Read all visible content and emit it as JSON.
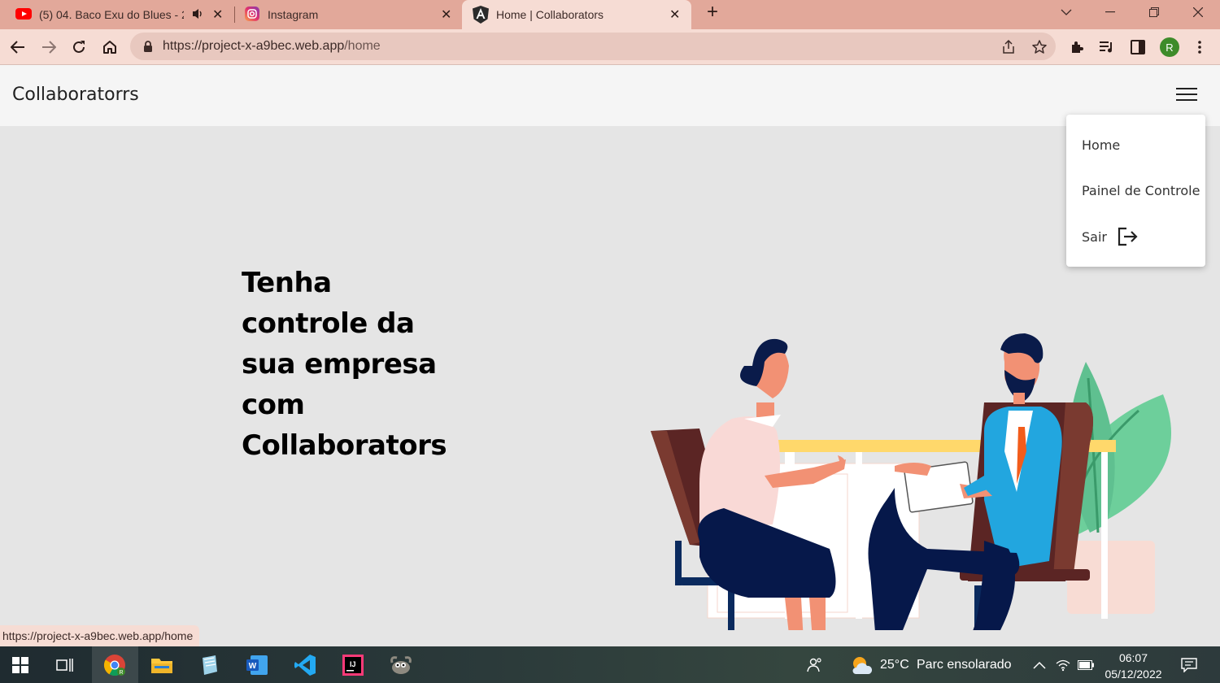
{
  "browser": {
    "tabs": [
      {
        "title": "(5) 04. Baco Exu do Blues - 2",
        "icon": "youtube-icon",
        "audio": "speaker-icon",
        "close": "✕"
      },
      {
        "title": "Instagram",
        "icon": "instagram-icon",
        "close": "✕"
      },
      {
        "title": "Home | Collaborators",
        "icon": "angular-icon",
        "close": "✕"
      }
    ],
    "new_tab": "+",
    "url_host": "https://project-x-a9bec.web.app",
    "url_path": "/home",
    "profile_initial": "R",
    "status_url": "https://project-x-a9bec.web.app/home"
  },
  "app": {
    "brand": "Collaboratorrs",
    "menu": {
      "items": [
        {
          "label": "Home"
        },
        {
          "label": "Painel de Controle"
        },
        {
          "label": "Sair",
          "icon": "logout-icon"
        }
      ]
    },
    "headline_lines": [
      "Tenha",
      "controle da",
      "sua empresa",
      "com",
      "Collaborators"
    ]
  },
  "taskbar": {
    "weather_temp": "25°C",
    "weather_text": "Parc ensolarado",
    "time": "06:07",
    "date": "05/12/2022",
    "apps": [
      "windows-start-icon",
      "task-view-icon",
      "chrome-icon",
      "file-explorer-icon",
      "notepad-icon",
      "word-icon",
      "vscode-icon",
      "intellij-icon",
      "gimp-icon"
    ]
  },
  "colors": {
    "tabbar": "#e2a89a",
    "toolbar": "#f6dcd4",
    "page_bg": "#e5e5e5",
    "navbar": "#f5f5f5"
  }
}
